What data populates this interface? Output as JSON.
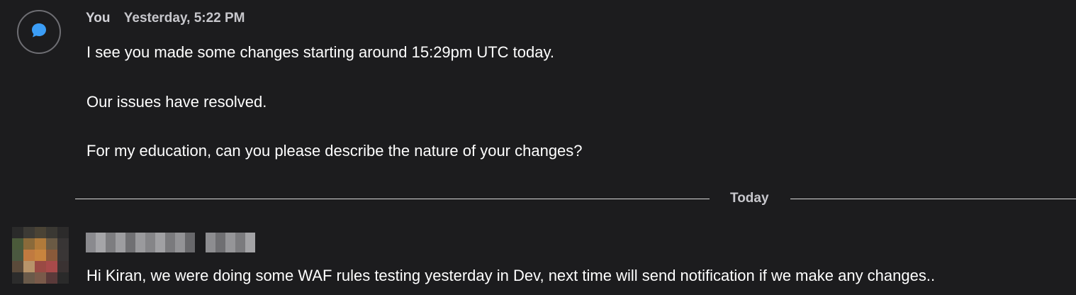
{
  "messages": [
    {
      "sender": "You",
      "timestamp": "Yesterday, 5:22 PM",
      "avatar_icon": "chat-bubble-icon",
      "lines": [
        "I see you made some changes starting around 15:29pm UTC today.",
        "Our issues have resolved.",
        "For my education, can you please describe the nature of your changes?"
      ]
    },
    {
      "sender_obscured": true,
      "avatar_icon": "pixelated-avatar",
      "lines": [
        "Hi Kiran, we were doing some WAF rules testing yesterday in Dev, next time will send notification if we make any changes.."
      ]
    }
  ],
  "divider": {
    "label": "Today"
  },
  "colors": {
    "background": "#1c1c1e",
    "accent_icon": "#3b9df6",
    "divider": "#d8d8d8"
  }
}
